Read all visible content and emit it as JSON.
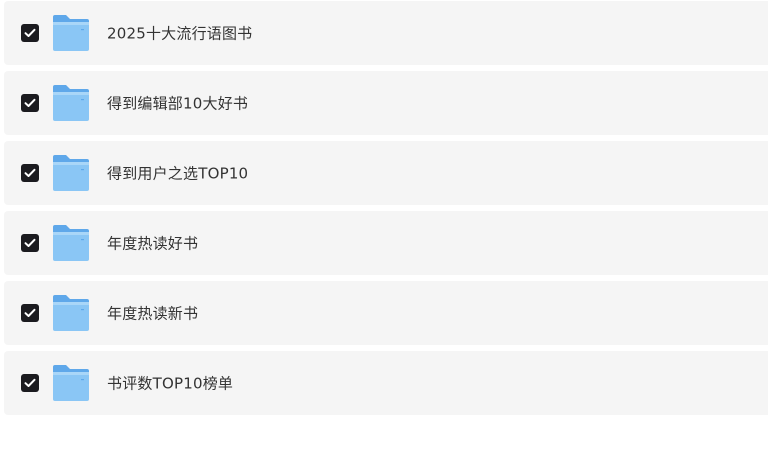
{
  "folders": [
    {
      "label": "2025十大流行语图书",
      "checked": true
    },
    {
      "label": "得到编辑部10大好书",
      "checked": true
    },
    {
      "label": "得到用户之选TOP10",
      "checked": true
    },
    {
      "label": "年度热读好书",
      "checked": true
    },
    {
      "label": "年度热读新书",
      "checked": true
    },
    {
      "label": "书评数TOP10榜单",
      "checked": true
    }
  ],
  "icons": {
    "checkbox": "checkbox-checked-icon",
    "folder": "folder-icon"
  },
  "colors": {
    "row_background": "#f5f5f5",
    "checkbox_fill": "#1b1b1f",
    "folder_blue": "#7fbdf2",
    "label_text": "#333333"
  }
}
